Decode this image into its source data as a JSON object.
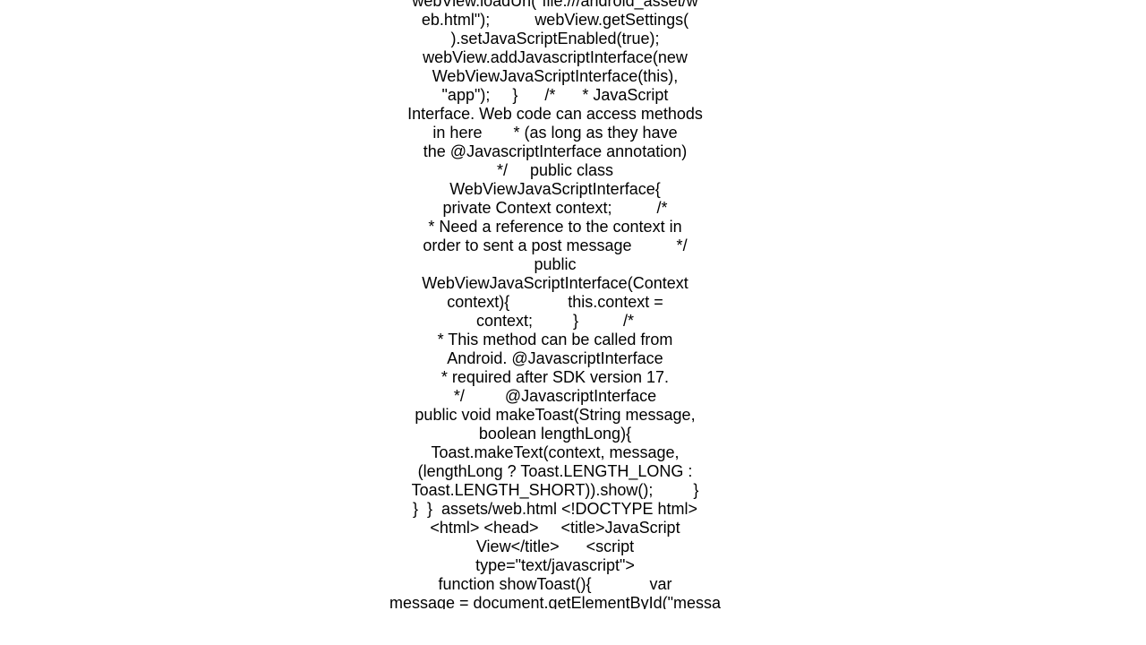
{
  "document": {
    "lines": [
      "webView.loadUrl(\"file:///android_asset/w",
      "eb.html\");          webView.getSettings(",
      ").setJavaScriptEnabled(true);",
      "webView.addJavascriptInterface(new",
      "WebViewJavaScriptInterface(this),",
      "\"app\");     }      /*      * JavaScript",
      "Interface. Web code can access methods",
      "in here       * (as long as they have",
      "the @JavascriptInterface annotation)",
      "*/     public class",
      "WebViewJavaScriptInterface{",
      "private Context context;          /*",
      "* Need a reference to the context in",
      "order to sent a post message          */",
      "public",
      "WebViewJavaScriptInterface(Context",
      "context){             this.context =",
      "context;         }          /*",
      "* This method can be called from",
      "Android. @JavascriptInterface",
      "* required after SDK version 17.",
      "*/         @JavascriptInterface",
      "public void makeToast(String message,",
      "boolean lengthLong){",
      "Toast.makeText(context, message,",
      "(lengthLong ? Toast.LENGTH_LONG :",
      "Toast.LENGTH_SHORT)).show();         }",
      "}  }  assets/web.html <!DOCTYPE html>",
      "<html> <head>     <title>JavaScript",
      "View</title>      <script",
      "type=\"text/javascript\">",
      "function showToast(){             var",
      "message = document.getElementById(\"messa"
    ]
  }
}
